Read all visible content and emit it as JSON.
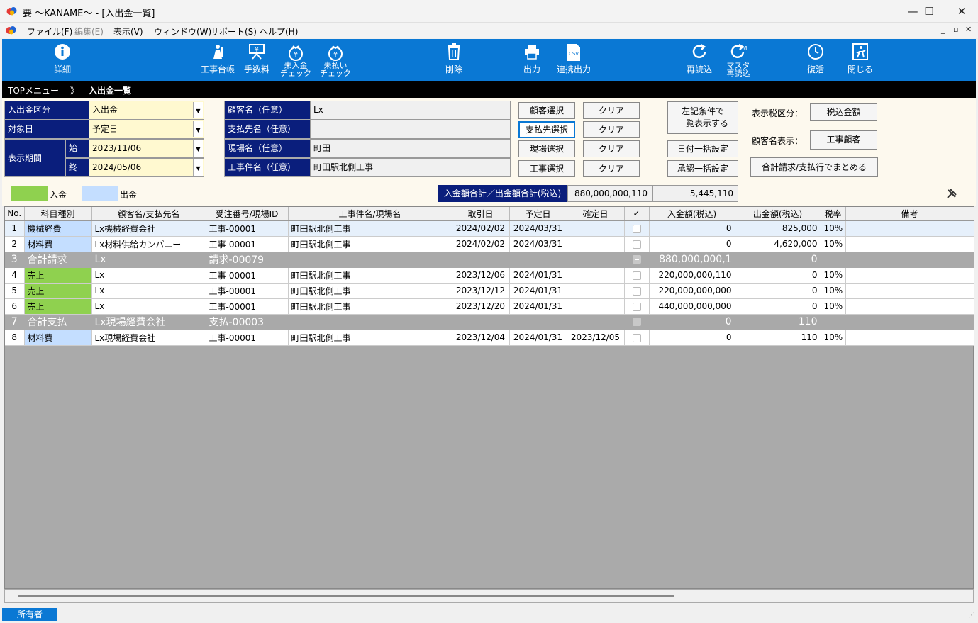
{
  "window": {
    "title": "要 ～KANAME～ - [入出金一覧]",
    "minimize": "—",
    "maximize": "☐",
    "close": "✕"
  },
  "menu": {
    "items": [
      {
        "label": "ファイル(F)",
        "disabled": false
      },
      {
        "label": "編集(E)",
        "disabled": true
      },
      {
        "label": "表示(V)",
        "disabled": false
      },
      {
        "label": "ウィンドウ(W)",
        "disabled": false
      },
      {
        "label": "サポート(S)",
        "disabled": false
      },
      {
        "label": "ヘルプ(H)",
        "disabled": false
      }
    ]
  },
  "toolbar": {
    "detail": "詳細",
    "project_ledger": "工事台帳",
    "fee": "手数料",
    "unreceived_1": "未入金",
    "unreceived_2": "チェック",
    "unpaid_1": "未払い",
    "unpaid_2": "チェック",
    "delete": "削除",
    "output": "出力",
    "linked_output": "連携出力",
    "csv_text": "CSV",
    "reload": "再読込",
    "master_reload_1": "マスタ",
    "master_reload_2": "再読込",
    "master_mark": "M",
    "restore": "復活",
    "close": "閉じる"
  },
  "breadcrumb": {
    "top": "TOPメニュー",
    "sep": "》",
    "current": "入出金一覧"
  },
  "filter": {
    "type_label": "入出金区分",
    "type_value": "入出金",
    "date_label": "対象日",
    "date_value": "予定日",
    "period_label": "表示期間",
    "start_label": "始",
    "start_value": "2023/11/06",
    "end_label": "終",
    "end_value": "2024/05/06",
    "customer_label": "顧客名（任意）",
    "customer_value": "Lx",
    "payee_label": "支払先名（任意）",
    "payee_value": "",
    "site_label": "現場名（任意）",
    "site_value": "町田",
    "project_label": "工事件名（任意）",
    "project_value": "町田駅北側工事",
    "btn_customer": "顧客選択",
    "btn_payee": "支払先選択",
    "btn_site": "現場選択",
    "btn_project": "工事選択",
    "btn_clear": "クリア",
    "btn_list_1": "左記条件で",
    "btn_list_2": "一覧表示する",
    "btn_date_bulk": "日付一括設定",
    "btn_approve_bulk": "承認一括設定",
    "tax_label": "表示税区分：",
    "tax_value": "税込金額",
    "cust_disp_label": "顧客名表示：",
    "cust_disp_value": "工事顧客",
    "btn_merge": "合計請求/支払行でまとめる"
  },
  "legend": {
    "income": "入金",
    "expense": "出金",
    "income_color": "#8fd14f",
    "expense_color": "#c4deff"
  },
  "totals": {
    "label": "入金額合計／出金額合計(税込)",
    "income": "880,000,000,110",
    "expense": "5,445,110"
  },
  "grid": {
    "headers": [
      "No.",
      "科目種別",
      "顧客名/支払先名",
      "受注番号/現場ID",
      "工事件名/現場名",
      "取引日",
      "予定日",
      "確定日",
      "✓",
      "入金額(税込)",
      "出金額(税込)",
      "税率",
      "備考"
    ],
    "rows": [
      {
        "kind": "row",
        "alt": true,
        "no": "1",
        "subject": "機械経費",
        "color": "blue",
        "name": "Lx機械経費会社",
        "order": "工事-00001",
        "project": "町田駅北側工事",
        "trade": "2024/02/02",
        "plan": "2024/03/31",
        "fixed": "",
        "inc": "0",
        "exp": "825,000",
        "tax": "10%",
        "note": ""
      },
      {
        "kind": "row",
        "alt": false,
        "no": "2",
        "subject": "材料費",
        "color": "blue",
        "name": "Lx材料供給カンパニー",
        "order": "工事-00001",
        "project": "町田駅北側工事",
        "trade": "2024/02/02",
        "plan": "2024/03/31",
        "fixed": "",
        "inc": "0",
        "exp": "4,620,000",
        "tax": "10%",
        "note": ""
      },
      {
        "kind": "grp",
        "no": "3",
        "subject": "合計請求",
        "name": "Lx",
        "order": "請求-00079",
        "inc": "880,000,000,1",
        "exp": "0"
      },
      {
        "kind": "row",
        "alt": false,
        "no": "4",
        "subject": "売上",
        "color": "green",
        "name": "Lx",
        "order": "工事-00001",
        "project": "町田駅北側工事",
        "trade": "2023/12/06",
        "plan": "2024/01/31",
        "fixed": "",
        "inc": "220,000,000,110",
        "exp": "0",
        "tax": "10%",
        "note": ""
      },
      {
        "kind": "row",
        "alt": false,
        "no": "5",
        "subject": "売上",
        "color": "green",
        "name": "Lx",
        "order": "工事-00001",
        "project": "町田駅北側工事",
        "trade": "2023/12/12",
        "plan": "2024/01/31",
        "fixed": "",
        "inc": "220,000,000,000",
        "exp": "0",
        "tax": "10%",
        "note": ""
      },
      {
        "kind": "row",
        "alt": false,
        "no": "6",
        "subject": "売上",
        "color": "green",
        "name": "Lx",
        "order": "工事-00001",
        "project": "町田駅北側工事",
        "trade": "2023/12/20",
        "plan": "2024/01/31",
        "fixed": "",
        "inc": "440,000,000,000",
        "exp": "0",
        "tax": "10%",
        "note": ""
      },
      {
        "kind": "grp",
        "no": "7",
        "subject": "合計支払",
        "name": "Lx現場経費会社",
        "order": "支払-00003",
        "inc": "0",
        "exp": "110"
      },
      {
        "kind": "row",
        "alt": false,
        "no": "8",
        "subject": "材料費",
        "color": "blue",
        "name": "Lx現場経費会社",
        "order": "工事-00001",
        "project": "町田駅北側工事",
        "trade": "2023/12/04",
        "plan": "2024/01/31",
        "fixed": "2023/12/05",
        "inc": "0",
        "exp": "110",
        "tax": "10%",
        "note": ""
      }
    ]
  },
  "status": {
    "owner": "所有者"
  }
}
